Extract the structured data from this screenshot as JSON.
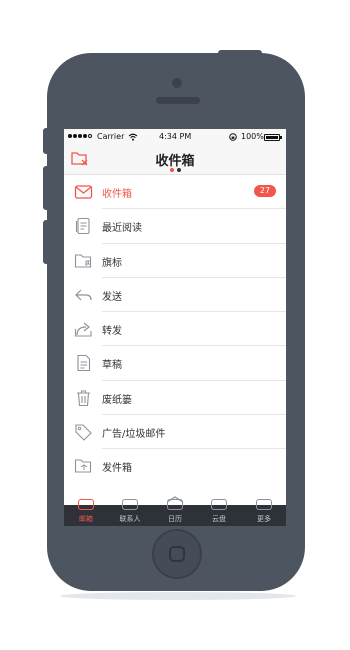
{
  "status_bar": {
    "carrier": "Carrier",
    "time": "4:34 PM",
    "battery": "100%"
  },
  "nav": {
    "title": "收件箱"
  },
  "folders": [
    {
      "label": "收件箱",
      "icon": "inbox-icon",
      "badge": "27",
      "active": true
    },
    {
      "label": "最近阅读",
      "icon": "recent-read-icon"
    },
    {
      "label": "旗标",
      "icon": "flag-folder-icon"
    },
    {
      "label": "发送",
      "icon": "sent-icon"
    },
    {
      "label": "转发",
      "icon": "forward-icon"
    },
    {
      "label": "草稿",
      "icon": "draft-icon"
    },
    {
      "label": "废纸篓",
      "icon": "trash-icon"
    },
    {
      "label": "广告/垃圾邮件",
      "icon": "spam-tag-icon"
    },
    {
      "label": "发件箱",
      "icon": "outbox-icon"
    }
  ],
  "tabbar": [
    {
      "label": "邮箱",
      "icon": "mail-tab-icon",
      "active": true
    },
    {
      "label": "联系人",
      "icon": "contacts-tab-icon"
    },
    {
      "label": "日历",
      "icon": "calendar-tab-icon"
    },
    {
      "label": "云盘",
      "icon": "cloud-drive-tab-icon"
    },
    {
      "label": "更多",
      "icon": "more-tab-icon"
    }
  ],
  "colors": {
    "accent": "#f2564b",
    "phone_body": "#4d5560",
    "tabbar_bg": "#2e3238"
  }
}
